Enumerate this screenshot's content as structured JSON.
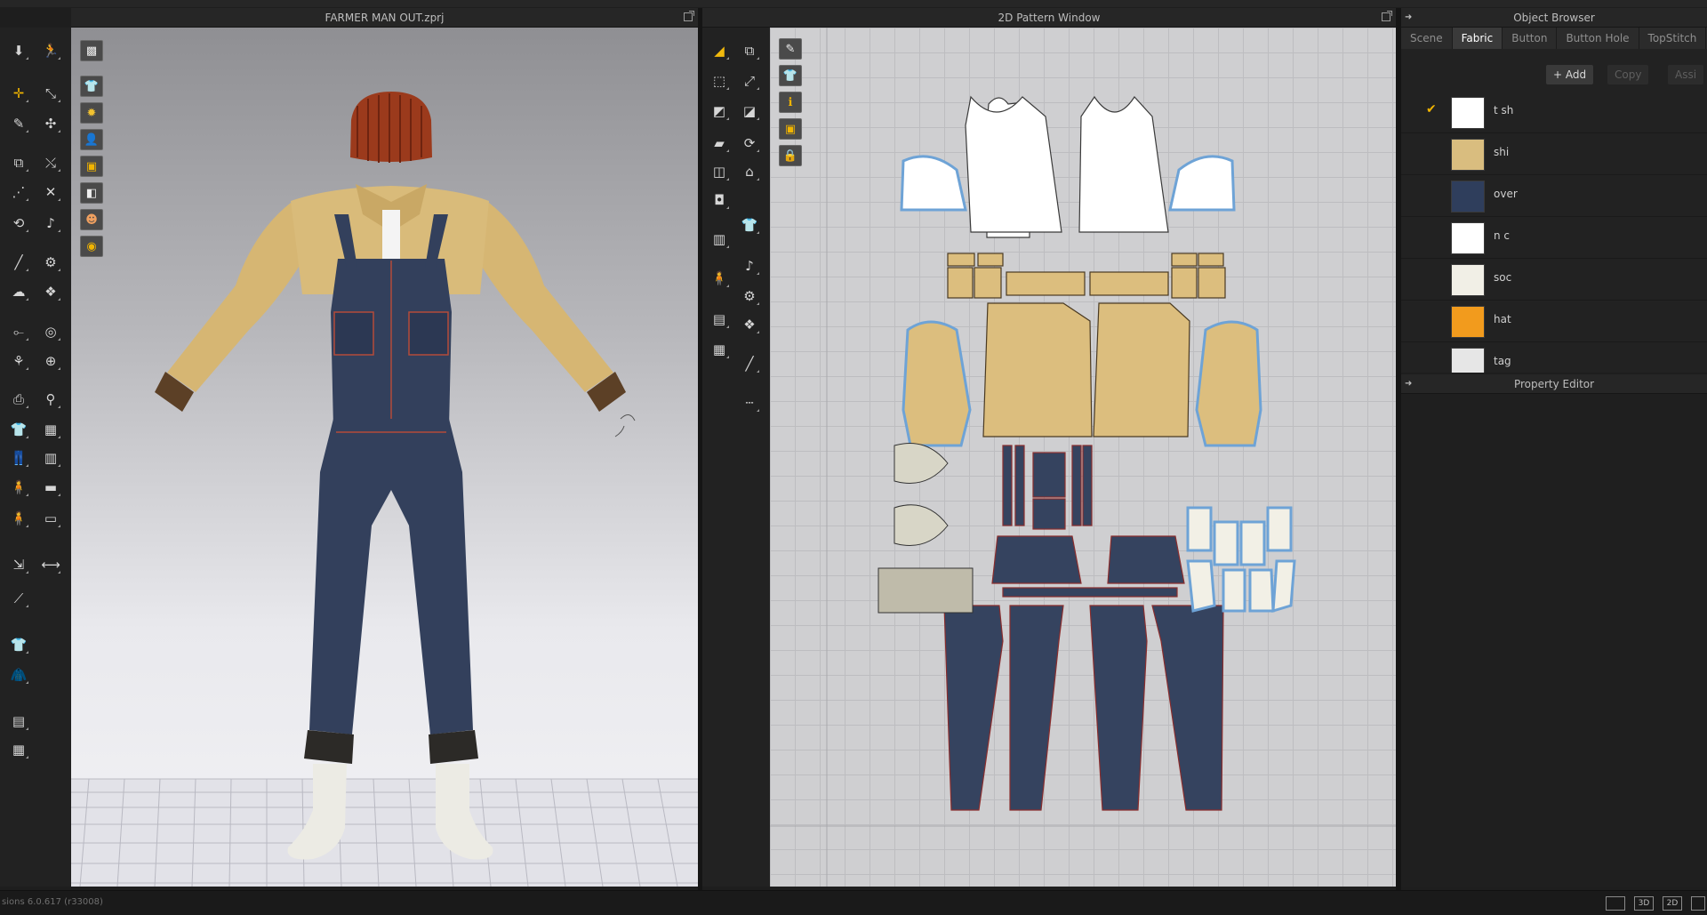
{
  "panels": {
    "view3d_title": "FARMER MAN OUT.zprj",
    "view2d_title": "2D Pattern Window",
    "object_browser_title": "Object Browser",
    "property_editor_title": "Property Editor"
  },
  "object_browser": {
    "tabs": [
      "Scene",
      "Fabric",
      "Button",
      "Button Hole",
      "TopStitch"
    ],
    "active_tab": "Fabric",
    "buttons": {
      "add": "+ Add",
      "copy": "Copy",
      "assign": "Assi"
    },
    "fabrics": [
      {
        "name": "t sh",
        "color": "#ffffff",
        "selected": true
      },
      {
        "name": "shi",
        "color": "#d9bd7f",
        "selected": false
      },
      {
        "name": "over",
        "color": "#2f3e5c",
        "selected": false
      },
      {
        "name": "n c",
        "color": "#ffffff",
        "selected": false
      },
      {
        "name": "soc",
        "color": "#f1efe6",
        "selected": false
      },
      {
        "name": "hat",
        "color": "#f29b1d",
        "selected": false
      },
      {
        "name": "tag",
        "color": "#e6e6e6",
        "selected": false
      }
    ]
  },
  "status": {
    "version_text": "sions 6.0.617 (r33008)",
    "view_buttons": [
      "",
      "3D",
      "2D",
      ""
    ]
  },
  "colors": {
    "shirt": "#d9bb7a",
    "denim": "#33405c",
    "hat": "#9b3a1c",
    "accent": "#f1b400"
  }
}
